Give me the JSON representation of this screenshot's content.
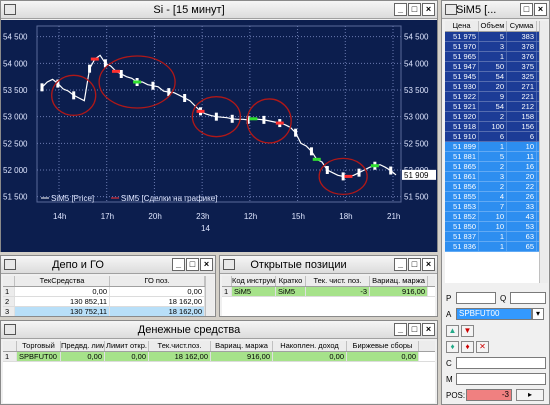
{
  "chart_win": {
    "title": "Si - [15 минут]"
  },
  "chart_data": {
    "type": "line",
    "title": "Si - [15 минут]",
    "y_ticks": [
      "54 500",
      "54 000",
      "53 500",
      "53 000",
      "52 500",
      "52 000",
      "51 500"
    ],
    "ylim": [
      51400,
      54700
    ],
    "last_label": "51 909",
    "x_ticks": [
      "14h",
      "17h",
      "20h",
      "23h",
      "12h",
      "15h",
      "18h",
      "21h"
    ],
    "x_day": "14",
    "series": [
      {
        "name": "SiM5 [Price]",
        "values": [
          53550,
          53650,
          53700,
          53620,
          53520,
          53480,
          53400,
          53350,
          53300,
          53900,
          54080,
          54150,
          54000,
          53950,
          53850,
          53800,
          53750,
          53720,
          53650,
          53650,
          53600,
          53580,
          53560,
          53480,
          53460,
          53450,
          53400,
          53350,
          53300,
          53200,
          53100,
          53050,
          53020,
          53000,
          52990,
          52980,
          52960,
          52950,
          52950,
          52940,
          52960,
          52950,
          52940,
          52920,
          52900,
          52880,
          52850,
          52800,
          52700,
          52500,
          52450,
          52350,
          52200,
          52150,
          52000,
          51950,
          51900,
          51880,
          51880,
          51900,
          51950,
          52000,
          52050,
          52080,
          52100,
          52050,
          51990,
          51909
        ]
      },
      {
        "name": "SiM5 [Сделки на графике]",
        "values": []
      }
    ]
  },
  "legend": {
    "price": "SiM5 [Price]",
    "deals": "SiM5 [Сделки на графике]"
  },
  "depo": {
    "title": "Депо и ГО",
    "cols": [
      "",
      "ТекСредства",
      "ГО поз."
    ],
    "rows": [
      [
        "1",
        "0,00",
        "0,00"
      ],
      [
        "2",
        "130 852,11",
        "18 162,00"
      ],
      [
        "3",
        "130 752,11",
        "18 162,00"
      ]
    ]
  },
  "positions": {
    "title": "Открытые позиции",
    "cols": [
      "",
      "Код инструм.",
      "Кратко",
      "Тек. чист. поз.",
      "Вариац. маржа"
    ],
    "rows": [
      [
        "1",
        "SiM5",
        "SiM5",
        "-3",
        "916,00"
      ]
    ]
  },
  "money": {
    "title": "Денежные средства",
    "cols": [
      "",
      "Торговый",
      "Предвд. лими",
      "Лимит откр.",
      "Тек.чист.поз.",
      "Вариац. маржа",
      "Накоплен. доход",
      "Биржевые сборы"
    ],
    "rows": [
      [
        "1",
        "SPBFUT00",
        "0,00",
        "0,00",
        "18 162,00",
        "916,00",
        "0,00",
        "0,00"
      ]
    ]
  },
  "quotes": {
    "title": "SiM5 [...",
    "cols": [
      "Цена",
      "Объем",
      "Сумма"
    ],
    "asks": [
      [
        "51 975",
        "5",
        "383"
      ],
      [
        "51 970",
        "3",
        "378"
      ],
      [
        "51 965",
        "1",
        "376"
      ],
      [
        "51 947",
        "50",
        "375"
      ],
      [
        "51 945",
        "54",
        "325"
      ],
      [
        "51 930",
        "20",
        "271"
      ],
      [
        "51 922",
        "9",
        "221"
      ],
      [
        "51 921",
        "54",
        "212"
      ],
      [
        "51 920",
        "2",
        "158"
      ],
      [
        "51 918",
        "100",
        "156"
      ],
      [
        "51 910",
        "6",
        "6"
      ]
    ],
    "bids": [
      [
        "51 899",
        "1",
        "10"
      ],
      [
        "51 881",
        "5",
        "11"
      ],
      [
        "51 865",
        "2",
        "16"
      ],
      [
        "51 861",
        "3",
        "20"
      ],
      [
        "51 856",
        "2",
        "22"
      ],
      [
        "51 855",
        "4",
        "26"
      ],
      [
        "51 853",
        "7",
        "33"
      ],
      [
        "51 852",
        "10",
        "43"
      ],
      [
        "51 850",
        "10",
        "53"
      ],
      [
        "51 837",
        "1",
        "63"
      ],
      [
        "51 836",
        "1",
        "65"
      ]
    ]
  },
  "order": {
    "p_label": "P",
    "q_label": "Q",
    "a_label": "A",
    "account": "SPBFUT00",
    "c_label": "C",
    "m_label": "M",
    "pos_label": "POS:",
    "pos_value": "-3"
  }
}
